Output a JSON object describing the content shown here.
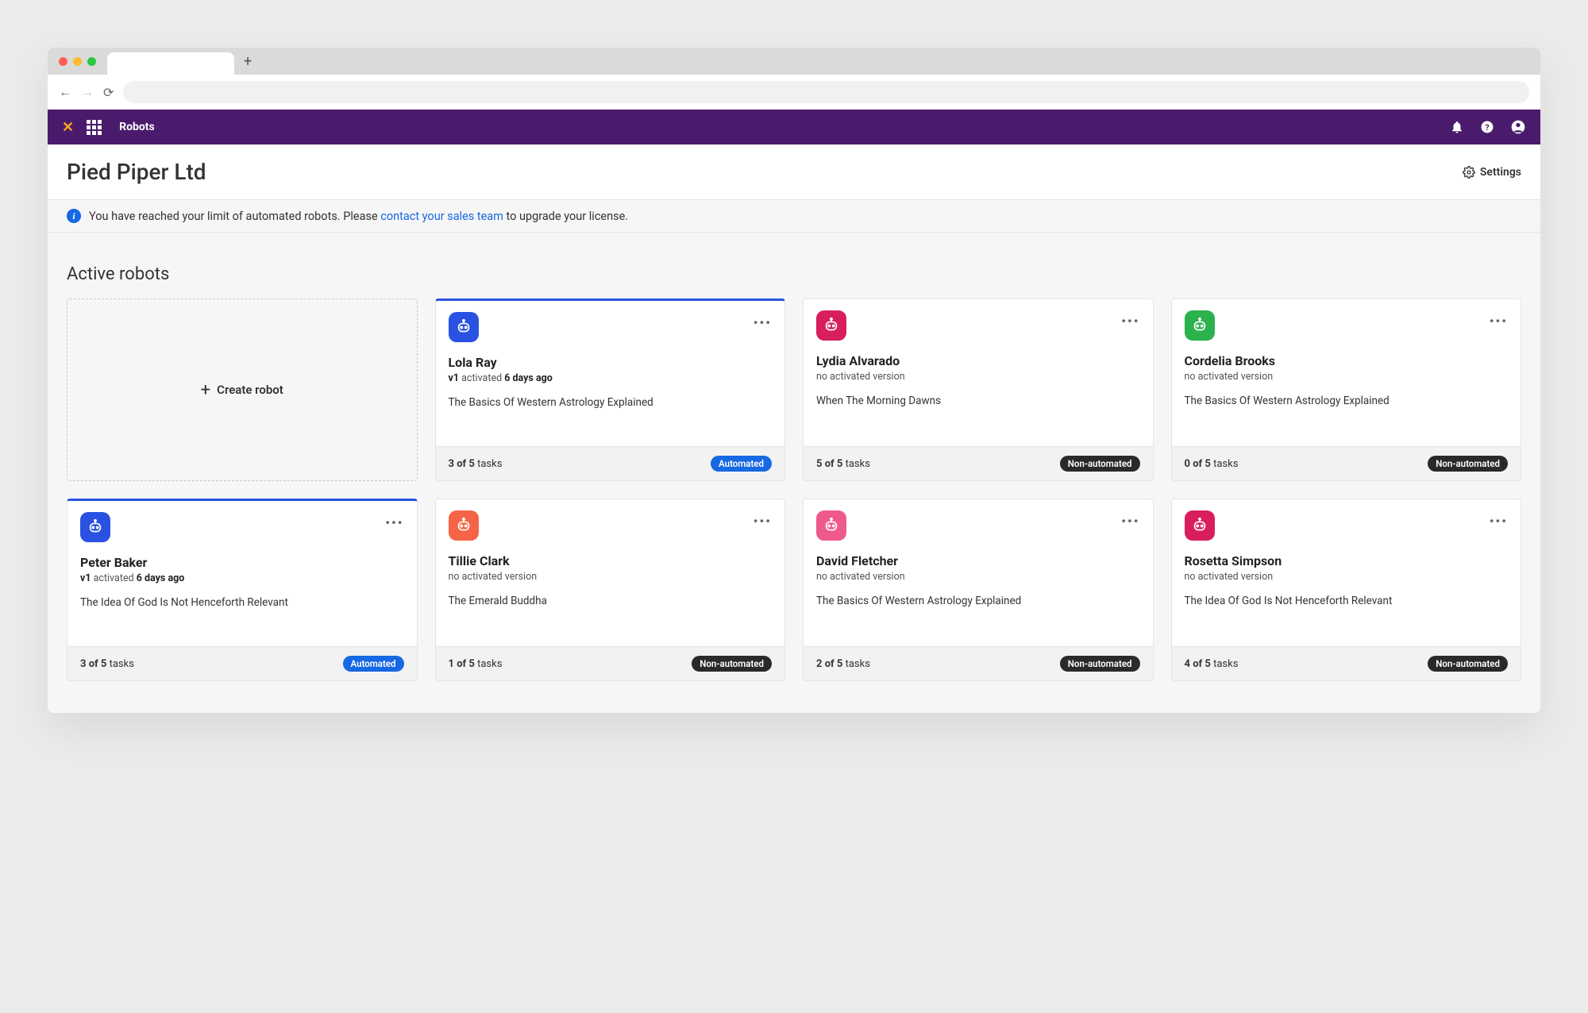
{
  "header": {
    "section": "Robots"
  },
  "page": {
    "title": "Pied Piper Ltd",
    "settings_label": "Settings"
  },
  "banner": {
    "prefix": "You have reached your limit of automated robots. Please ",
    "link": "contact your sales team",
    "suffix": " to upgrade your license."
  },
  "section": {
    "title": "Active robots"
  },
  "create": {
    "label": "Create robot"
  },
  "labels": {
    "tasks_word": "tasks",
    "of": "of",
    "activated": "activated",
    "no_activated": "no activated version"
  },
  "pills": {
    "auto": "Automated",
    "non": "Non-automated"
  },
  "robots": [
    {
      "name": "Lola Ray",
      "version": "v1",
      "ago": "6 days ago",
      "desc": "The Basics Of Western Astrology Explained",
      "done": 3,
      "total": 5,
      "automated": true,
      "color": "#2952e3",
      "highlighted": true
    },
    {
      "name": "Lydia Alvarado",
      "version": null,
      "ago": null,
      "desc": "When The Morning Dawns",
      "done": 5,
      "total": 5,
      "automated": false,
      "color": "#d81f5b",
      "highlighted": false
    },
    {
      "name": "Cordelia Brooks",
      "version": null,
      "ago": null,
      "desc": "The Basics Of Western Astrology Explained",
      "done": 0,
      "total": 5,
      "automated": false,
      "color": "#2bb24c",
      "highlighted": false
    },
    {
      "name": "Peter Baker",
      "version": "v1",
      "ago": "6 days ago",
      "desc": "The Idea Of God Is Not Henceforth Relevant",
      "done": 3,
      "total": 5,
      "automated": true,
      "color": "#2952e3",
      "highlighted": true
    },
    {
      "name": "Tillie Clark",
      "version": null,
      "ago": null,
      "desc": "The Emerald Buddha",
      "done": 1,
      "total": 5,
      "automated": false,
      "color": "#f56447",
      "highlighted": false
    },
    {
      "name": "David Fletcher",
      "version": null,
      "ago": null,
      "desc": "The Basics Of Western Astrology Explained",
      "done": 2,
      "total": 5,
      "automated": false,
      "color": "#ee5a8d",
      "highlighted": false
    },
    {
      "name": "Rosetta Simpson",
      "version": null,
      "ago": null,
      "desc": "The Idea Of God Is Not Henceforth Relevant",
      "done": 4,
      "total": 5,
      "automated": false,
      "color": "#d81f5b",
      "highlighted": false
    }
  ]
}
